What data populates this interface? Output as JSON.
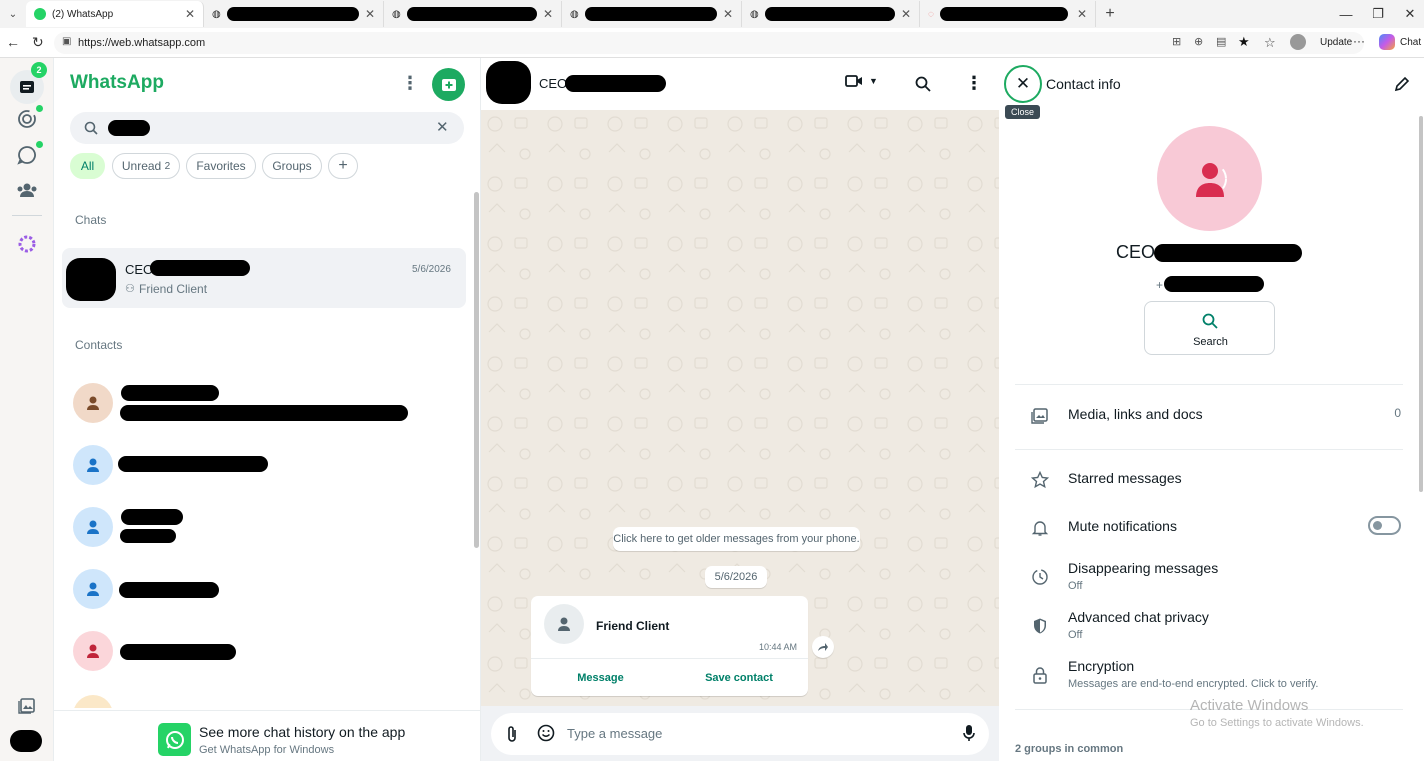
{
  "browser": {
    "active_tab": "(2) WhatsApp",
    "url": "https://web.whatsapp.com",
    "update_label": "Update",
    "chat_label": "Chat"
  },
  "rail": {
    "chats_badge": "2"
  },
  "sidebar": {
    "title": "WhatsApp",
    "filters": [
      {
        "label": "All"
      },
      {
        "label": "Unread",
        "count": "2"
      },
      {
        "label": "Favorites"
      },
      {
        "label": "Groups"
      }
    ],
    "chats_heading": "Chats",
    "chat": {
      "name_prefix": "CEO",
      "date": "5/6/2026",
      "preview": "Friend Client"
    },
    "contacts_heading": "Contacts",
    "promo": {
      "title": "See more chat history on the app",
      "subtitle": "Get WhatsApp for Windows"
    }
  },
  "conversation": {
    "name_prefix": "CEO",
    "older_messages": "Click here to get older messages from your phone.",
    "date_pill": "5/6/2026",
    "card": {
      "name": "Friend Client",
      "time": "10:44 AM",
      "message_label": "Message",
      "save_label": "Save contact"
    },
    "composer_placeholder": "Type a message"
  },
  "contact_info": {
    "title": "Contact info",
    "close_tooltip": "Close",
    "name_prefix": "CEO",
    "phone_prefix": "+",
    "search_label": "Search",
    "media_label": "Media, links and docs",
    "media_count": "0",
    "starred": "Starred messages",
    "mute": "Mute notifications",
    "disappearing": {
      "title": "Disappearing messages",
      "value": "Off"
    },
    "privacy": {
      "title": "Advanced chat privacy",
      "value": "Off"
    },
    "encryption": {
      "title": "Encryption",
      "sub": "Messages are end-to-end encrypted. Click to verify."
    },
    "groups_common": "2 groups in common"
  },
  "watermark": {
    "line1": "Activate Windows",
    "line2": "Go to Settings to activate Windows."
  },
  "colors": {
    "brand": "#1daa61",
    "accent": "#008069",
    "chat_bg": "#efeae2"
  }
}
